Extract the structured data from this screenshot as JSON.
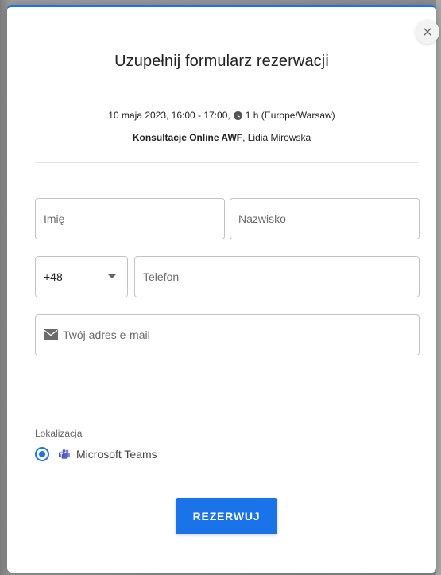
{
  "dialog": {
    "title": "Uzupełnij formularz rezerwacji",
    "datetime": "10 maja 2023, 16:00 - 17:00,",
    "duration": "1 h (Europe/Warsaw)",
    "service": "Konsultacje Online AWF",
    "provider": ", Lidia Mirowska",
    "close_icon": "close-icon"
  },
  "form": {
    "first_name_placeholder": "Imię",
    "last_name_placeholder": "Nazwisko",
    "phone_prefix": "+48",
    "phone_placeholder": "Telefon",
    "email_placeholder": "Twój adres e-mail"
  },
  "location": {
    "label": "Lokalizacja",
    "option": "Microsoft Teams",
    "selected": true
  },
  "submit_label": "REZERWUJ",
  "colors": {
    "accent": "#1a73e8",
    "teams": "#5b5fc7"
  }
}
